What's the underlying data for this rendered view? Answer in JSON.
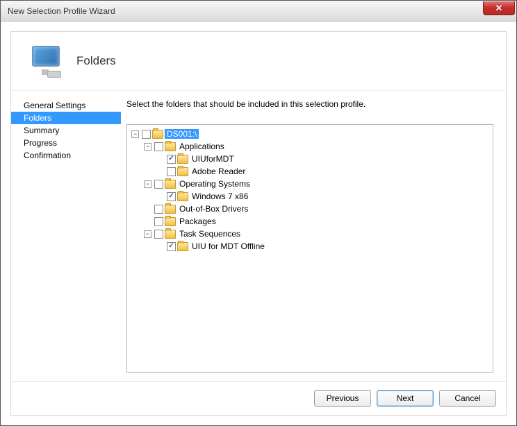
{
  "window": {
    "title": "New Selection Profile Wizard",
    "close_label": "✕"
  },
  "header": {
    "title": "Folders"
  },
  "sidebar": {
    "items": [
      {
        "label": "General Settings",
        "active": false
      },
      {
        "label": "Folders",
        "active": true
      },
      {
        "label": "Summary",
        "active": false
      },
      {
        "label": "Progress",
        "active": false
      },
      {
        "label": "Confirmation",
        "active": false
      }
    ]
  },
  "content": {
    "instruction": "Select the folders that should be included in this selection profile."
  },
  "tree": {
    "root": {
      "label": "DS001:\\",
      "expanded": true,
      "checked": false,
      "selected": true,
      "children": [
        {
          "label": "Applications",
          "expanded": true,
          "checked": false,
          "children": [
            {
              "label": "UIUforMDT",
              "checked": true
            },
            {
              "label": "Adobe Reader",
              "checked": false
            }
          ]
        },
        {
          "label": "Operating Systems",
          "expanded": true,
          "checked": false,
          "children": [
            {
              "label": "Windows 7 x86",
              "checked": true
            }
          ]
        },
        {
          "label": "Out-of-Box Drivers",
          "checked": false
        },
        {
          "label": "Packages",
          "checked": false
        },
        {
          "label": "Task Sequences",
          "expanded": true,
          "checked": false,
          "children": [
            {
              "label": "UIU for MDT Offline",
              "checked": true
            }
          ]
        }
      ]
    }
  },
  "buttons": {
    "previous": "Previous",
    "next": "Next",
    "cancel": "Cancel"
  }
}
